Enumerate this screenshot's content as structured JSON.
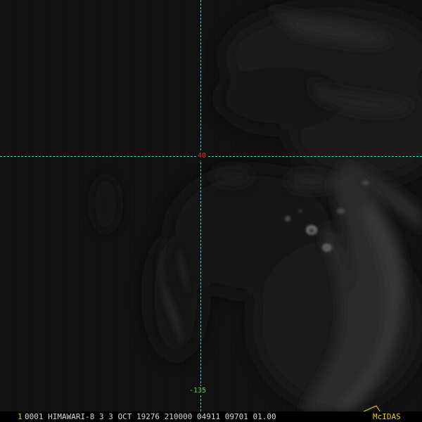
{
  "image": {
    "satellite": "HIMAWARI-8",
    "kind": "visible satellite imagery, monochrome"
  },
  "colors": {
    "background": "#101010",
    "grid": "#39d6d6",
    "lat_label": "#e23030",
    "lon_label": "#40e040",
    "frame_number": "#f0d000",
    "info_text": "#d8d8d8",
    "brand": "#f0d000"
  },
  "grid": {
    "latitude_label": "40",
    "longitude_label": "-135"
  },
  "status_bar": {
    "frame_number": "1",
    "info": "0001 HIMAWARI-8   3   3 OCT 19276 210000 04911 09701 01.00",
    "brand": "McIDAS"
  }
}
